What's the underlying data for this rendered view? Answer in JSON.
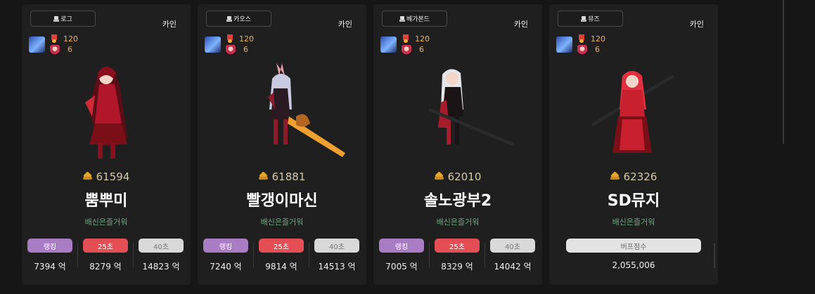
{
  "cards": [
    {
      "job": "로그",
      "server": "카인",
      "level": "120",
      "level2": "6",
      "fame": "61594",
      "name": "뿜뿌미",
      "guild": "배신은즐거워",
      "rank_label": "랭킹",
      "s25_label": "25초",
      "s40_label": "40초",
      "rank_val": "7394 억",
      "s25_val": "8279 억",
      "s40_val": "14823 억",
      "colors": {
        "primary": "#b2162b",
        "secondary": "#5a0f16",
        "hair": "#8a1020",
        "skin": "#f3d6c8"
      }
    },
    {
      "job": "카오스",
      "server": "카인",
      "level": "120",
      "level2": "6",
      "fame": "61881",
      "name": "빨갱이마신",
      "guild": "배신은즐거워",
      "rank_label": "랭킹",
      "s25_label": "25초",
      "s40_label": "40초",
      "rank_val": "7240 억",
      "s25_val": "9814 억",
      "s40_val": "14513 억",
      "colors": {
        "primary": "#2a1a22",
        "secondary": "#8e1b2a",
        "hair": "#c8cbe0",
        "skin": "#f3d6c8",
        "weapon": "#f0a030"
      }
    },
    {
      "job": "베가본드",
      "server": "카인",
      "level": "120",
      "level2": "6",
      "fame": "62010",
      "name": "솔노광부2",
      "guild": "배신은즐거워",
      "rank_label": "랭킹",
      "s25_label": "25초",
      "s40_label": "40초",
      "rank_val": "7005 억",
      "s25_val": "8329 억",
      "s40_val": "14042 억",
      "colors": {
        "primary": "#1a1416",
        "secondary": "#a51c2a",
        "hair": "#e6e6ea",
        "skin": "#f3d6c8",
        "weapon": "#2b2b2e"
      }
    },
    {
      "job": "뮤즈",
      "server": "카인",
      "level": "120",
      "level2": "6",
      "fame": "62326",
      "name": "SD뮤지",
      "guild": "배신은즐거워",
      "buff_label": "버프점수",
      "buff_val": "2,055,006",
      "colors": {
        "primary": "#c8202f",
        "secondary": "#7a0f18",
        "hair": "#e03040",
        "skin": "#f3d6c8",
        "weapon": "#2b2b2e"
      }
    }
  ]
}
